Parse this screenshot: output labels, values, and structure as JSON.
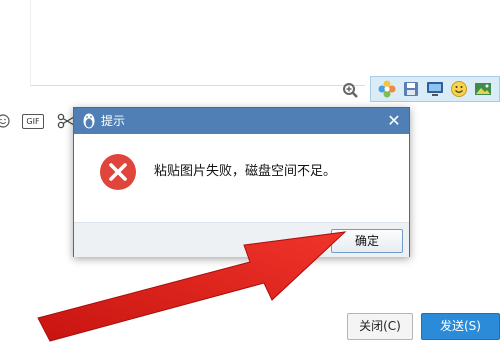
{
  "dialog": {
    "title": "提示",
    "message": "粘贴图片失败，磁盘空间不足。",
    "ok_label": "确定",
    "close_glyph": "✕",
    "icon": "error-icon"
  },
  "input_toolbar": {
    "gif_label": "GIF",
    "icons": [
      "smile-icon",
      "gif-icon",
      "scissors-icon"
    ]
  },
  "side_toolbar": {
    "icons": [
      "zoom-icon",
      "flower-icon",
      "save-icon",
      "monitor-icon",
      "emoticon-icon",
      "photo-icon"
    ]
  },
  "bottom": {
    "close_label": "关闭(C)",
    "send_label": "发送(S)"
  },
  "annotation": {
    "arrow_color": "#e8231e"
  },
  "colors": {
    "title_bar": "#4f7fb4",
    "send_button": "#2c8bd8",
    "error_red": "#e0453b"
  }
}
